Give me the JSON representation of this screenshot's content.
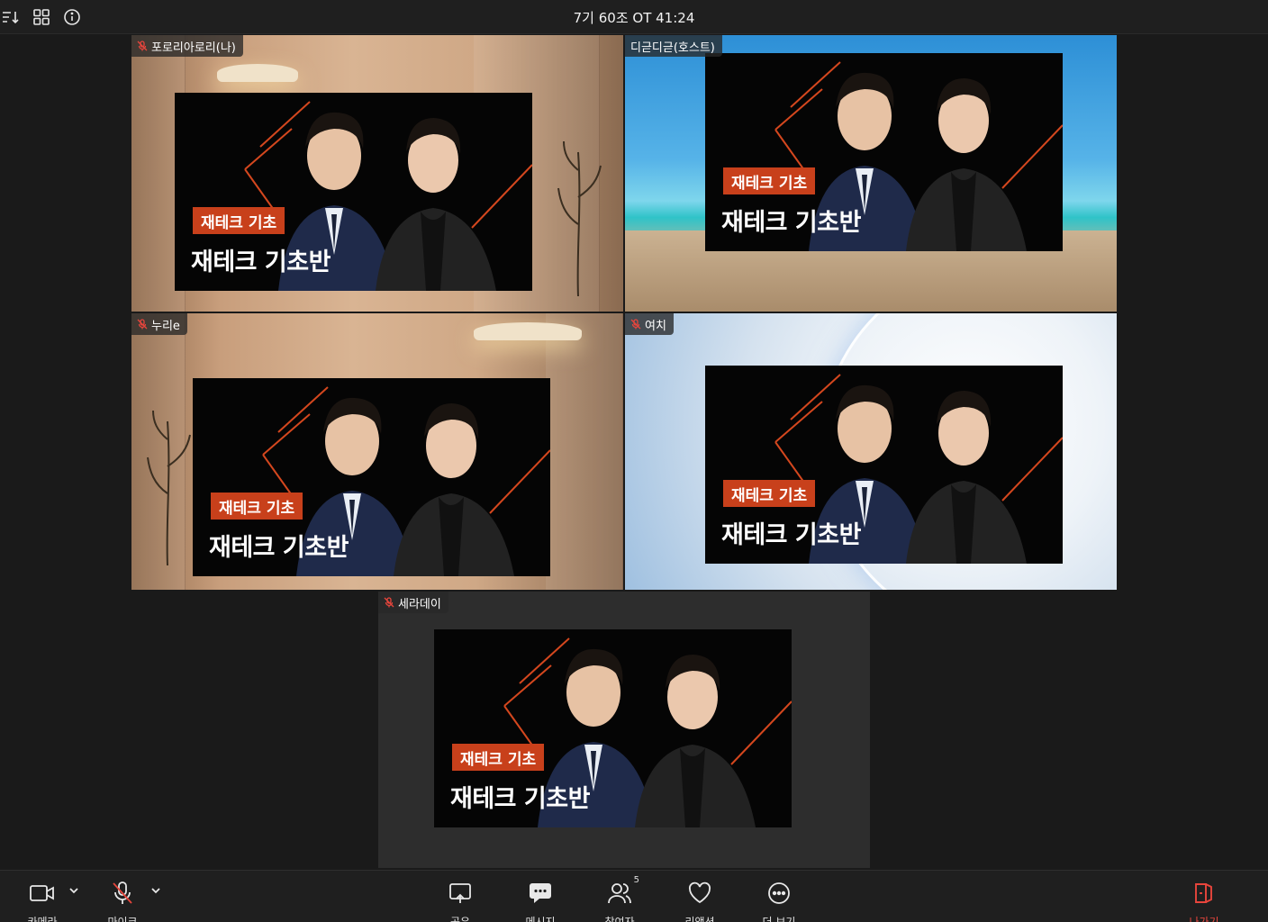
{
  "meeting": {
    "title": "7기 60조 OT 41:24"
  },
  "participants": [
    {
      "name": "포로리아로리(나)",
      "muted": true
    },
    {
      "name": "디귿디귿(호스트)",
      "muted": false
    },
    {
      "name": "누리e",
      "muted": true
    },
    {
      "name": "여치",
      "muted": true
    },
    {
      "name": "세라데이",
      "muted": true
    }
  ],
  "slide": {
    "badge": "재테크 기초",
    "course": "재테크 기초반"
  },
  "toolbar": {
    "camera": "카메라",
    "mic": "마이크",
    "share": "공유",
    "message": "메시지",
    "participants": "참여자",
    "participants_count": "5",
    "reaction": "리액션",
    "more": "더 보기",
    "leave": "나가기"
  },
  "colors": {
    "accent": "#c8401b",
    "leave": "#e8453c",
    "muted": "#e8453c"
  },
  "icons": [
    "sort-icon",
    "grid-icon",
    "info-icon",
    "camera-icon",
    "mic-off-icon",
    "share-icon",
    "message-icon",
    "participants-icon",
    "heart-icon",
    "more-icon",
    "leave-icon"
  ]
}
